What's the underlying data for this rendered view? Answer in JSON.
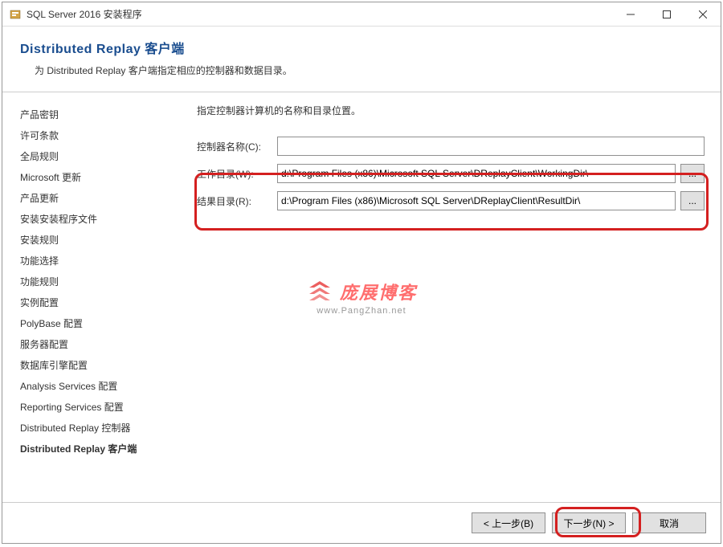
{
  "window": {
    "title": "SQL Server 2016 安装程序"
  },
  "header": {
    "title": "Distributed  Replay 客户端",
    "description": "为 Distributed Replay 客户端指定相应的控制器和数据目录。"
  },
  "sidebar": {
    "items": [
      {
        "label": "产品密钥"
      },
      {
        "label": "许可条款"
      },
      {
        "label": "全局规则"
      },
      {
        "label": "Microsoft 更新"
      },
      {
        "label": "产品更新"
      },
      {
        "label": "安装安装程序文件"
      },
      {
        "label": "安装规则"
      },
      {
        "label": "功能选择"
      },
      {
        "label": "功能规则"
      },
      {
        "label": "实例配置"
      },
      {
        "label": "PolyBase 配置"
      },
      {
        "label": "服务器配置"
      },
      {
        "label": "数据库引擎配置"
      },
      {
        "label": "Analysis Services 配置"
      },
      {
        "label": "Reporting Services 配置"
      },
      {
        "label": "Distributed Replay 控制器"
      },
      {
        "label": "Distributed Replay 客户端",
        "active": true
      }
    ]
  },
  "main": {
    "intro": "指定控制器计算机的名称和目录位置。",
    "controller_label": "控制器名称(C):",
    "controller_value": "",
    "working_dir_label": "工作目录(W):",
    "working_dir_value": "d:\\Program Files (x86)\\Microsoft SQL Server\\DReplayClient\\WorkingDir\\",
    "result_dir_label": "结果目录(R):",
    "result_dir_value": "d:\\Program Files (x86)\\Microsoft SQL Server\\DReplayClient\\ResultDir\\",
    "browse_label": "..."
  },
  "footer": {
    "back": "< 上一步(B)",
    "next": "下一步(N) >",
    "cancel": "取消"
  },
  "watermark": {
    "text": "庞展博客",
    "url": "www.PangZhan.net"
  }
}
